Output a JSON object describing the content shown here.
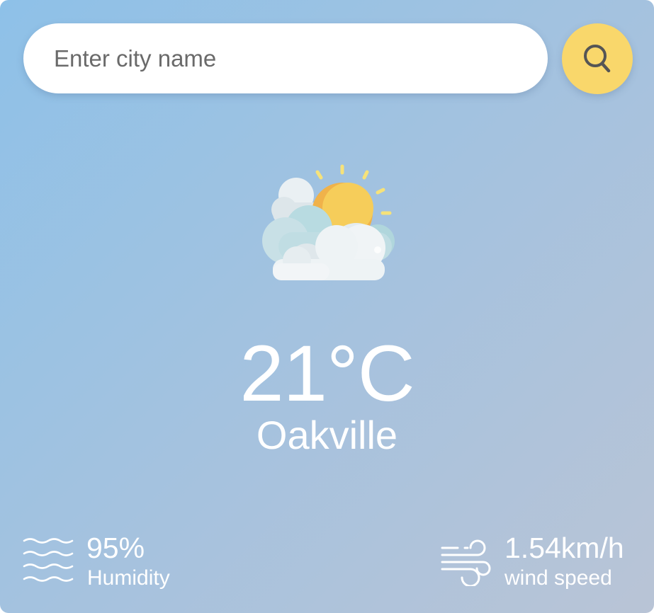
{
  "search": {
    "placeholder": "Enter city name",
    "value": "",
    "button_icon": "search-icon"
  },
  "weather": {
    "condition_icon": "partly-cloudy-icon",
    "temperature": "21°C",
    "city": "Oakville"
  },
  "details": {
    "humidity": {
      "icon": "humidity-icon",
      "value": "95%",
      "label": "Humidity"
    },
    "wind": {
      "icon": "wind-icon",
      "value": "1.54km/h",
      "label": "wind speed"
    }
  },
  "colors": {
    "background_start": "#8ec1e8",
    "background_end": "#b9c4d6",
    "search_button": "#f9d76b",
    "text": "#ffffff"
  }
}
